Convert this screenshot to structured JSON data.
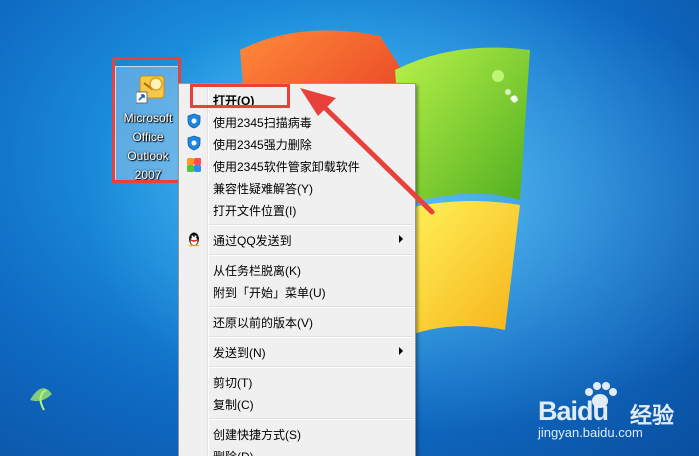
{
  "desktop_icon": {
    "label": "Microsoft Office Outlook 2007",
    "icon": "outlook-shortcut-icon"
  },
  "context_menu": {
    "items": [
      {
        "label": "打开(O)",
        "icon": null,
        "bold": true
      },
      {
        "label": "使用2345扫描病毒",
        "icon": "shield-blue-icon"
      },
      {
        "label": "使用2345强力删除",
        "icon": "shield-blue-icon"
      },
      {
        "label": "使用2345软件管家卸载软件",
        "icon": "colorful-squares-icon"
      },
      {
        "label": "兼容性疑难解答(Y)",
        "icon": null
      },
      {
        "label": "打开文件位置(I)",
        "icon": null
      },
      {
        "label": "通过QQ发送到",
        "icon": "qq-penguin-icon",
        "submenu": true
      },
      {
        "label": "从任务栏脱离(K)",
        "icon": null
      },
      {
        "label": "附到「开始」菜单(U)",
        "icon": null
      },
      {
        "label": "还原以前的版本(V)",
        "icon": null
      },
      {
        "label": "发送到(N)",
        "icon": null,
        "submenu": true
      },
      {
        "label": "剪切(T)",
        "icon": null
      },
      {
        "label": "复制(C)",
        "icon": null
      },
      {
        "label": "创建快捷方式(S)",
        "icon": null
      },
      {
        "label": "删除(D)",
        "icon": null
      }
    ]
  },
  "annotation": {
    "highlight_color": "#e8403a"
  },
  "watermark": {
    "brand": "Baidu",
    "product": "经验",
    "url": "jingyan.baidu.com"
  }
}
